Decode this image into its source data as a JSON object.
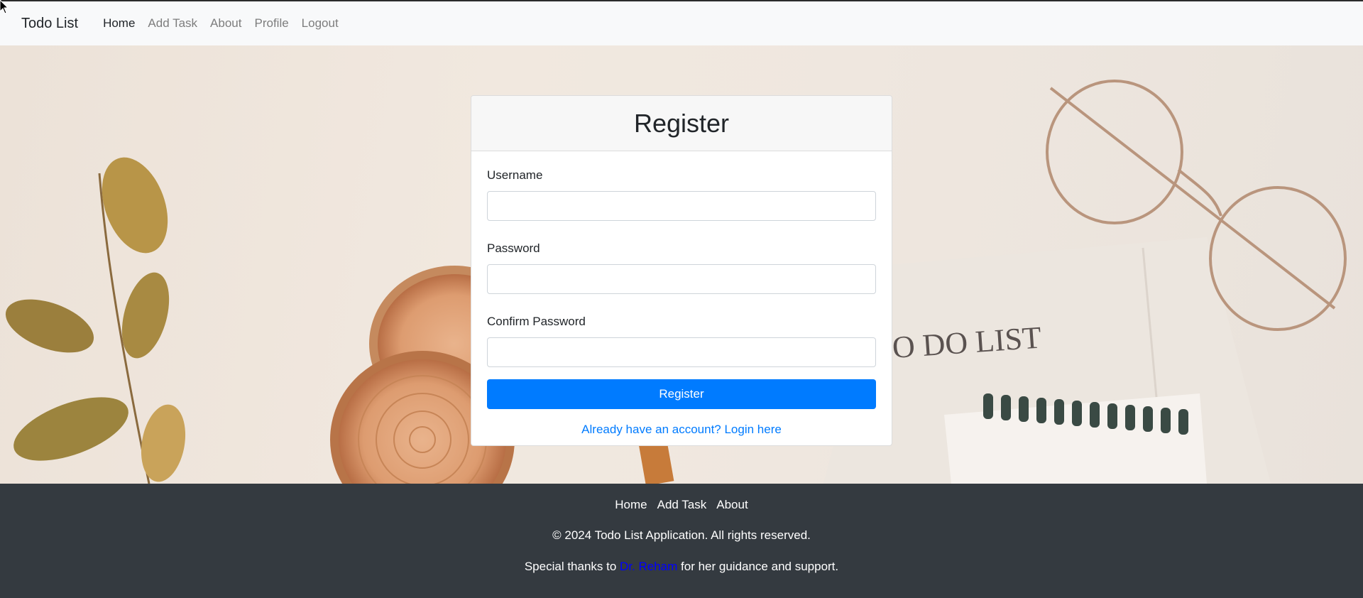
{
  "navbar": {
    "brand": "Todo List",
    "links": [
      {
        "label": "Home",
        "active": true
      },
      {
        "label": "Add Task",
        "active": false
      },
      {
        "label": "About",
        "active": false
      },
      {
        "label": "Profile",
        "active": false
      },
      {
        "label": "Logout",
        "active": false
      }
    ]
  },
  "background": {
    "notebook_text": "O DO LIST"
  },
  "register_card": {
    "title": "Register",
    "fields": [
      {
        "label": "Username",
        "value": "",
        "type": "text"
      },
      {
        "label": "Password",
        "value": "",
        "type": "password"
      },
      {
        "label": "Confirm Password",
        "value": "",
        "type": "password"
      }
    ],
    "submit_label": "Register",
    "login_link": "Already have an account? Login here"
  },
  "footer": {
    "links": [
      "Home",
      "Add Task",
      "About"
    ],
    "copyright": "© 2024 Todo List Application. All rights reserved.",
    "thanks_prefix": "Special thanks to",
    "thanks_name": "Dr. Reham",
    "thanks_suffix": "for her guidance and support."
  },
  "colors": {
    "primary": "#007bff",
    "footer_bg": "#343a40",
    "navbar_bg": "#f8f9fa",
    "thanks_name": "#0000ff"
  }
}
